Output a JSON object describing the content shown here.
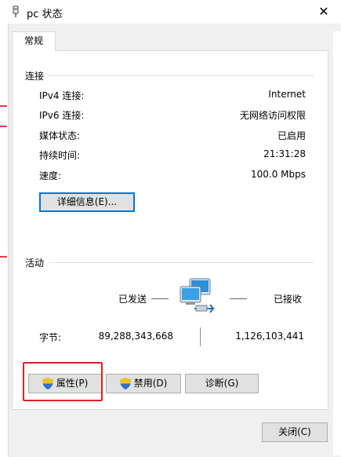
{
  "window": {
    "title": "pc 状态",
    "close_glyph": "✕"
  },
  "tab": {
    "label": "常规"
  },
  "connection": {
    "section_title": "连接",
    "rows": [
      {
        "label": "IPv4 连接:",
        "value": "Internet"
      },
      {
        "label": "IPv6 连接:",
        "value": "无网络访问权限"
      },
      {
        "label": "媒体状态:",
        "value": "已启用"
      },
      {
        "label": "持续时间:",
        "value": "21:31:28"
      },
      {
        "label": "速度:",
        "value": "100.0 Mbps"
      }
    ],
    "details_button": "详细信息(E)..."
  },
  "activity": {
    "section_title": "活动",
    "sent_label": "已发送",
    "received_label": "已接收",
    "bytes_label": "字节:",
    "bytes_sent": "89,288,343,668",
    "bytes_received": "1,126,103,441"
  },
  "buttons": {
    "properties": "属性(P)",
    "disable": "禁用(D)",
    "diagnose": "诊断(G)",
    "close": "关闭(C)"
  },
  "colors": {
    "accent": "#0078d7",
    "highlight": "#e02020"
  }
}
